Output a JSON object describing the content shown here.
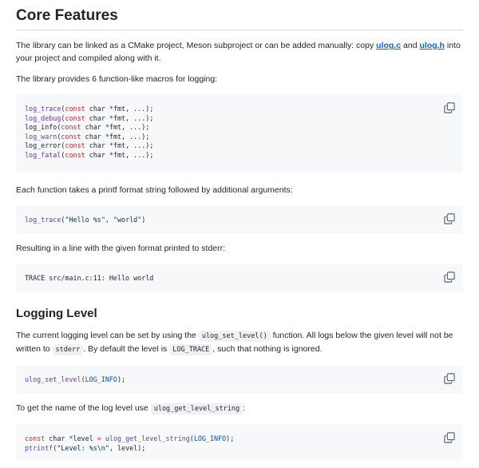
{
  "section1": {
    "heading": "Core Features",
    "p1_a": "The library can be linked as a CMake project, Meson subproject or can be added manually: copy ",
    "link1": "ulog.c",
    "p1_b": " and ",
    "link2": "ulog.h",
    "p1_c": " into your project and compiled along with it.",
    "p2": "The library provides 6 function-like macros for logging:",
    "macros": [
      {
        "name": "log_trace",
        "kw": "const",
        "rest1": " char ",
        "star": "*",
        "rest2": "fmt, ...);"
      },
      {
        "name": "log_debug",
        "kw": "const",
        "rest1": " char ",
        "star": "*",
        "rest2": "fmt, ...);"
      },
      {
        "name": "log_info",
        "kw": "const",
        "rest1": " char ",
        "star": "*",
        "rest2": "fmt, ...);"
      },
      {
        "name": "log_warn",
        "kw": "const",
        "rest1": " char ",
        "star": "*",
        "rest2": "fmt, ...);"
      },
      {
        "name": "log_error",
        "kw": "const",
        "rest1": " char ",
        "star": "*",
        "rest2": "fmt, ...);"
      },
      {
        "name": "log_fatal",
        "kw": "const",
        "rest1": " char ",
        "star": "*",
        "rest2": "fmt, ...);"
      }
    ],
    "p3": "Each function takes a printf format string followed by additional arguments:",
    "example_fn": "log_trace",
    "example_open": "(",
    "example_str1": "\"Hello %s\"",
    "example_comma": ", ",
    "example_str2": "\"world\"",
    "example_close": ")",
    "p4": "Resulting in a line with the given format printed to stderr:",
    "output_line": "TRACE src/main.c:11: Hello world"
  },
  "section2": {
    "heading": "Logging Level",
    "p1_a": "The current logging level can be set by using the ",
    "code1": "ulog_set_level()",
    "p1_b": " function. All logs below the given level will not be written to ",
    "code2": "stderr",
    "p1_c": ". By default the level is ",
    "code3": "LOG_TRACE",
    "p1_d": ", such that nothing is ignored.",
    "set_fn": "ulog_set_level",
    "set_open": "(",
    "set_arg": "LOG_INFO",
    "set_close": ");",
    "p2_a": "To get the name of the log level use ",
    "code4": "ulog_get_level_string",
    "p2_b": ":",
    "get_kw": "const",
    "get_type": " char ",
    "get_star": "*",
    "get_var": "level ",
    "get_eq": "=",
    "get_sp": " ",
    "get_fn": "ulog_get_level_string",
    "get_open": "(",
    "get_arg": "LOG_INFO",
    "get_close": ");",
    "print_fn": "ptrintf",
    "print_open": "(",
    "print_str": "\"Level: %s\\n\"",
    "print_rest": ", level);"
  }
}
